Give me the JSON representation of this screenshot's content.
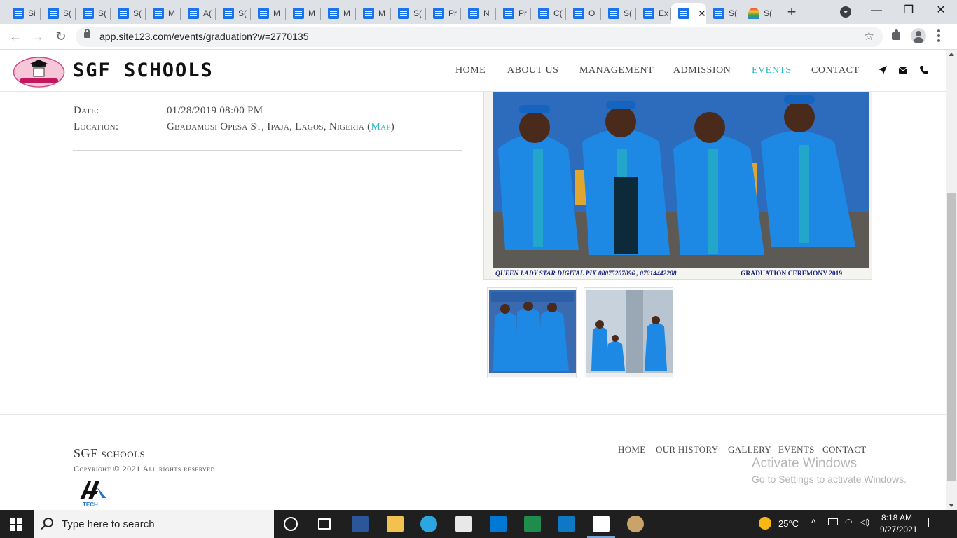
{
  "browser": {
    "tabs": [
      {
        "label": "Si",
        "icon": "docs-icon"
      },
      {
        "label": "S(",
        "icon": "docs-icon"
      },
      {
        "label": "S(",
        "icon": "docs-icon"
      },
      {
        "label": "S(",
        "icon": "docs-icon"
      },
      {
        "label": "M",
        "icon": "docs-icon"
      },
      {
        "label": "A(",
        "icon": "docs-icon"
      },
      {
        "label": "S(",
        "icon": "docs-icon"
      },
      {
        "label": "M",
        "icon": "docs-icon"
      },
      {
        "label": "M",
        "icon": "docs-icon"
      },
      {
        "label": "M",
        "icon": "docs-icon"
      },
      {
        "label": "M",
        "icon": "docs-icon"
      },
      {
        "label": "S(",
        "icon": "docs-icon"
      },
      {
        "label": "Pr",
        "icon": "docs-icon"
      },
      {
        "label": "N",
        "icon": "docs-icon"
      },
      {
        "label": "Pr",
        "icon": "docs-icon"
      },
      {
        "label": "C(",
        "icon": "docs-icon"
      },
      {
        "label": "O",
        "icon": "docs-icon"
      },
      {
        "label": "S(",
        "icon": "docs-icon"
      },
      {
        "label": "Ex",
        "icon": "docs-icon"
      },
      {
        "label": "",
        "icon": "docs-icon",
        "active": true
      },
      {
        "label": "S(",
        "icon": "docs-icon"
      },
      {
        "label": "S(",
        "icon": "rainbow-icon"
      }
    ],
    "url": "app.site123.com/events/graduation?w=2770135"
  },
  "site": {
    "brand": "SGF SCHOOLS",
    "nav": [
      "HOME",
      "ABOUT US",
      "MANAGEMENT",
      "ADMISSION",
      "EVENTS",
      "CONTACT"
    ],
    "active_nav": "EVENTS",
    "accent_color": "#2bb5c7"
  },
  "event": {
    "date_label": "Date:",
    "date_value": "01/28/2019 08:00 PM",
    "location_label": "Location:",
    "location_value": "Gbadamosi Opesa St, Ipaja, Lagos, Nigeria",
    "map_open": "(",
    "map_label": "Map",
    "map_close": ")",
    "photo_caption_left": "QUEEN LADY STAR DIGITAL PIX 08075207096 , 07014442208",
    "photo_caption_right": "GRADUATION CEREMONY 2019"
  },
  "footer": {
    "title": "SGF schools",
    "copyright": "Copyright © 2021 All rights reserved",
    "nav": [
      "HOME",
      "OUR HISTORY",
      "GALLERY",
      "EVENTS",
      "CONTACT"
    ],
    "logo_text": "TECH"
  },
  "watermark": {
    "title": "Activate Windows",
    "subtitle": "Go to Settings to activate Windows."
  },
  "taskbar": {
    "search_placeholder": "Type here to search",
    "temperature": "25°C",
    "time": "8:18 AM",
    "date": "9/27/2021"
  }
}
